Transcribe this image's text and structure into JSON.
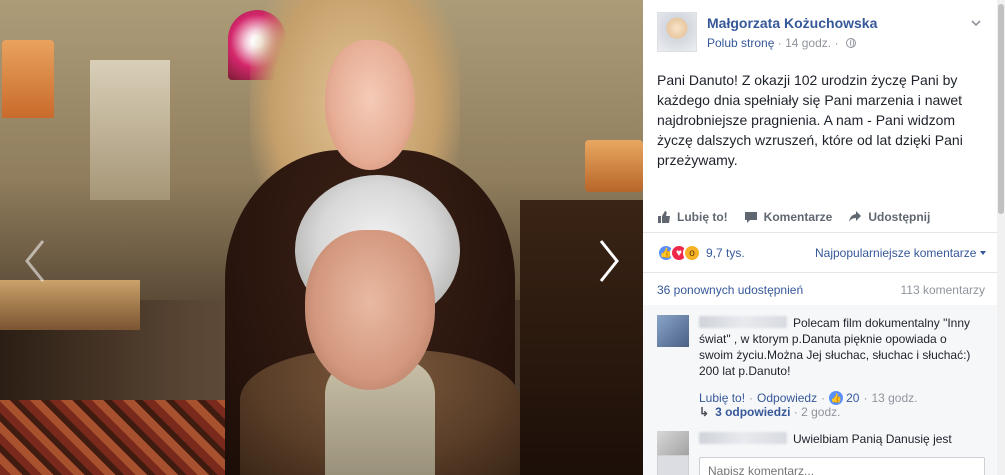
{
  "post": {
    "page_name": "Małgorzata Kożuchowska",
    "like_page": "Polub stronę",
    "dot": "·",
    "time": "14 godz.",
    "text": "Pani Danuto! Z okazji 102 urodzin życzę Pani by każdego dnia spełniały się Pani marzenia i nawet najdrobniejsze pragnienia. A nam - Pani widzom życzę dalszych wzruszeń, które od lat dzięki Pani przeżywamy."
  },
  "actions": {
    "like": "Lubię to!",
    "comment": "Komentarze",
    "share": "Udostępnij"
  },
  "reactions": {
    "count": "9,7 tys.",
    "sort_label": "Najpopularniejsze komentarze"
  },
  "stats": {
    "shares": "36 ponownych udostępnień",
    "comments": "113 komentarzy"
  },
  "comments": [
    {
      "text": "Polecam film dokumentalny \"Inny świat\" , w ktorym p.Danuta pięknie opowiada o swoim życiu.Można Jej słuchac, słuchac i słuchać:) 200 lat p.Danuto!",
      "like": "Lubię to!",
      "reply": "Odpowiedz",
      "likes": "20",
      "time": "13 godz.",
      "replies_label": "3 odpowiedzi",
      "replies_time": "2 godz."
    },
    {
      "text": "Uwielbiam Panią Danusię jest"
    }
  ],
  "composer": {
    "placeholder": "Napisz komentarz..."
  },
  "colors": {
    "link": "#365899",
    "muted": "#90949c",
    "like": "#5890ff",
    "love": "#f0284a",
    "wow": "#f7b125"
  }
}
